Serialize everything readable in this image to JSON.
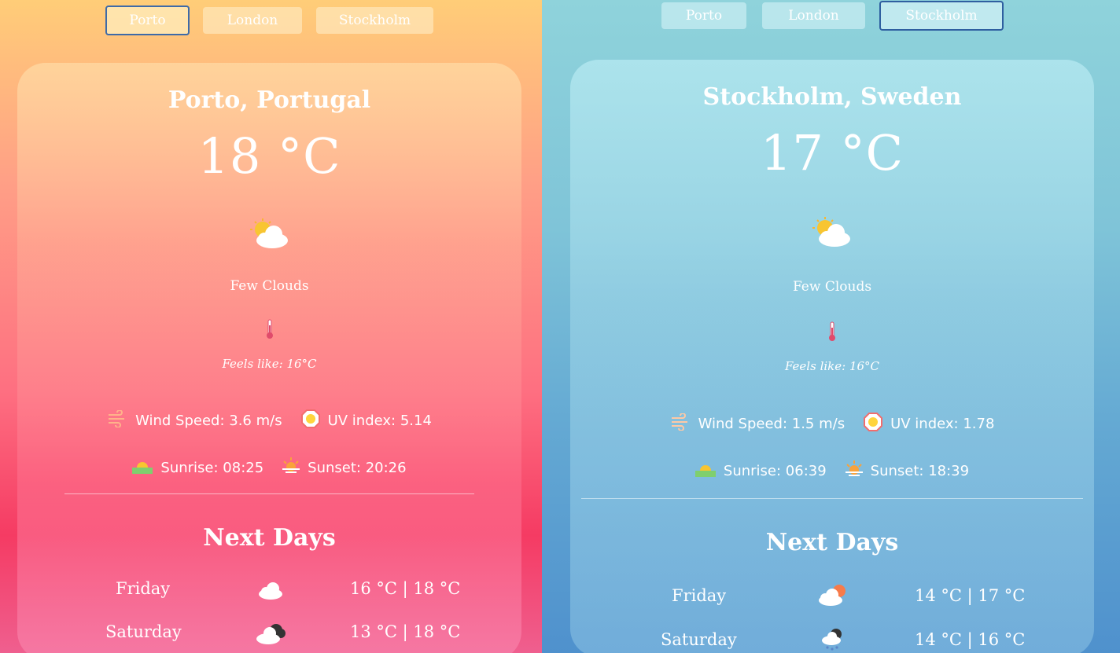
{
  "porto_panel": {
    "tabs": [
      "Porto",
      "London",
      "Stockholm"
    ],
    "active_tab": "Porto",
    "city": "Porto, Portugal",
    "temperature": "18 °C",
    "condition": "Few Clouds",
    "feels_like": "Feels like: 16°C",
    "wind": "Wind Speed: 3.6 m/s",
    "uv": "UV index: 5.14",
    "sunrise": "Sunrise: 08:25",
    "sunset": "Sunset: 20:26",
    "next_days_title": "Next Days",
    "forecast": [
      {
        "day": "Friday",
        "icon": "cloud-icon",
        "temps": "16 °C | 18 °C"
      },
      {
        "day": "Saturday",
        "icon": "dark-cloud-icon",
        "temps": "13 °C | 18 °C"
      }
    ]
  },
  "stockholm_panel": {
    "tabs": [
      "Porto",
      "London",
      "Stockholm"
    ],
    "active_tab": "Stockholm",
    "city": "Stockholm, Sweden",
    "temperature": "17 °C",
    "condition": "Few Clouds",
    "feels_like": "Feels like: 16°C",
    "wind": "Wind Speed: 1.5 m/s",
    "uv": "UV index: 1.78",
    "sunrise": "Sunrise: 06:39",
    "sunset": "Sunset: 18:39",
    "next_days_title": "Next Days",
    "forecast": [
      {
        "day": "Friday",
        "icon": "cloud-sun-icon",
        "temps": "14 °C | 17 °C"
      },
      {
        "day": "Saturday",
        "icon": "rain-cloud-icon",
        "temps": "14 °C | 16 °C"
      }
    ]
  },
  "colors": {
    "porto_top": "#ffcd78",
    "porto_bottom": "#f53b63",
    "stockholm_top": "#8fd3db",
    "stockholm_bottom": "#4f91cd",
    "active_tab_border": "#3d6aa8"
  }
}
